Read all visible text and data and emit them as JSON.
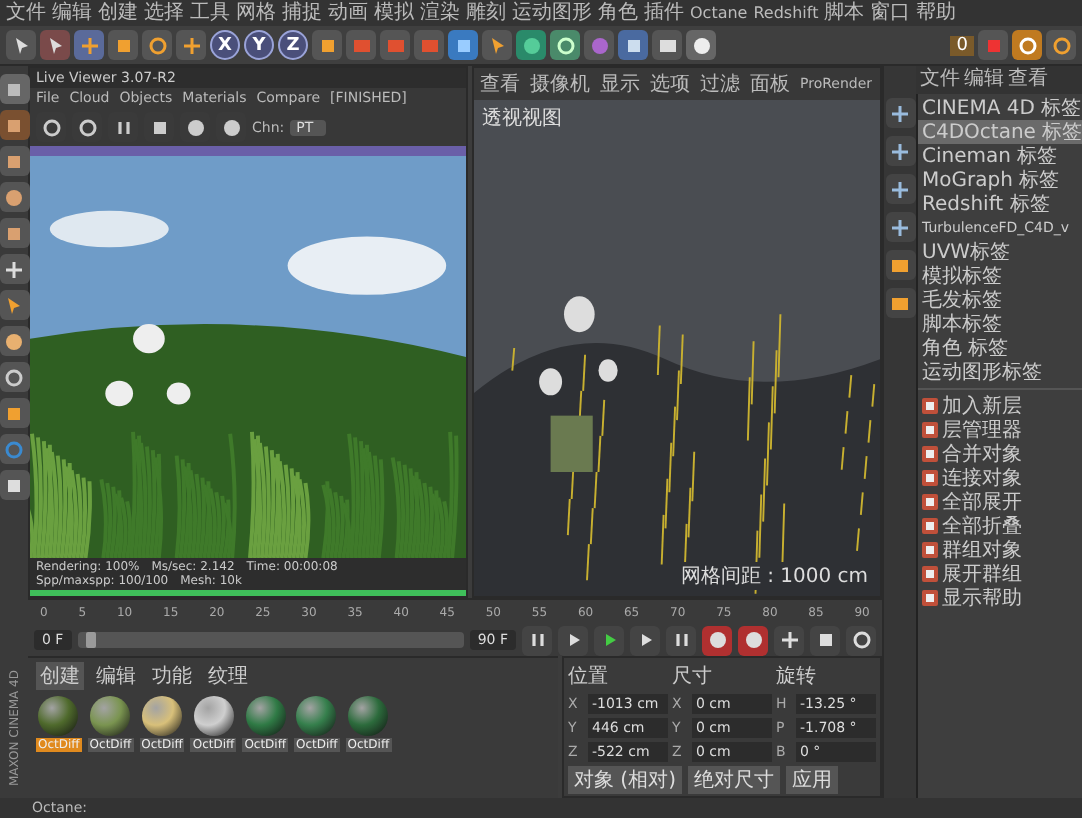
{
  "menu_bar": [
    "文件",
    "编辑",
    "创建",
    "选择",
    "工具",
    "网格",
    "捕捉",
    "动画",
    "模拟",
    "渲染",
    "雕刻",
    "运动图形",
    "角色",
    "插件",
    "Octane",
    "Redshift",
    "脚本",
    "窗口",
    "帮助"
  ],
  "toolbar": {
    "axes": [
      "X",
      "Y",
      "Z"
    ],
    "counter": "0"
  },
  "live_viewer": {
    "title": "Live Viewer 3.07-R2",
    "menu": [
      "File",
      "Cloud",
      "Objects",
      "Materials",
      "Compare"
    ],
    "state": "[FINISHED]",
    "channel_label": "Chn:",
    "channel": "PT",
    "stats": [
      "Rendering: 100%",
      "Ms/sec: 2.142",
      "Time: 00:00:08",
      "Spp/maxspp: 100/100",
      "Mesh: 10k"
    ],
    "progress": {
      "level": 1
    }
  },
  "viewport": {
    "menu": [
      "查看",
      "摄像机",
      "显示",
      "选项",
      "过滤",
      "面板",
      "ProRender"
    ],
    "label": "透视视图",
    "grid_spacing": "网格间距 : 1000 cm"
  },
  "object_manager": {
    "menu": [
      "文件",
      "编辑",
      "查看"
    ]
  },
  "tag_menu": [
    {
      "kind": "text",
      "label": "CINEMA 4D 标签",
      "selected": false
    },
    {
      "kind": "text",
      "label": "C4DOctane 标签",
      "selected": true
    },
    {
      "kind": "text",
      "label": "Cineman 标签",
      "selected": false
    },
    {
      "kind": "text",
      "label": "MoGraph 标签",
      "selected": false
    },
    {
      "kind": "text",
      "label": "Redshift 标签",
      "selected": false
    },
    {
      "kind": "text",
      "label": "TurbulenceFD_C4D_v",
      "selected": false
    },
    {
      "kind": "text",
      "label": "UVW标签",
      "selected": false
    },
    {
      "kind": "text",
      "label": "模拟标签",
      "selected": false
    },
    {
      "kind": "text",
      "label": "毛发标签",
      "selected": false
    },
    {
      "kind": "text",
      "label": "脚本标签",
      "selected": false
    },
    {
      "kind": "text",
      "label": "角色 标签",
      "selected": false
    },
    {
      "kind": "text",
      "label": "运动图形标签",
      "selected": false
    },
    {
      "kind": "separator"
    },
    {
      "kind": "icon",
      "label": "加入新层",
      "selected": false
    },
    {
      "kind": "icon",
      "label": "层管理器",
      "selected": false
    },
    {
      "kind": "icon",
      "label": "合并对象",
      "selected": false
    },
    {
      "kind": "icon",
      "label": "连接对象",
      "selected": false
    },
    {
      "kind": "icon",
      "label": "全部展开",
      "selected": false
    },
    {
      "kind": "icon",
      "label": "全部折叠",
      "selected": false
    },
    {
      "kind": "icon",
      "label": "群组对象",
      "selected": false
    },
    {
      "kind": "icon",
      "label": "展开群组",
      "selected": false
    },
    {
      "kind": "icon",
      "label": "显示帮助",
      "selected": false
    }
  ],
  "timeline": {
    "ticks": [
      "0",
      "5",
      "10",
      "15",
      "20",
      "25",
      "30",
      "35",
      "40",
      "45",
      "50",
      "55",
      "60",
      "65",
      "70",
      "75",
      "80",
      "85",
      "90"
    ],
    "start": "0 F",
    "end": "90 F",
    "slider": {
      "level": 0.03
    }
  },
  "materials": {
    "tabs": [
      {
        "label": "创建",
        "selected": true
      },
      {
        "label": "编辑",
        "selected": false
      },
      {
        "label": "功能",
        "selected": false
      },
      {
        "label": "纹理",
        "selected": false
      }
    ],
    "items": [
      {
        "name": "OctDiff",
        "color": "#4f6a2c",
        "selected": true
      },
      {
        "name": "OctDiff",
        "color": "#7a9450",
        "selected": false
      },
      {
        "name": "OctDiff",
        "color": "#d8c07a",
        "selected": false
      },
      {
        "name": "OctDiff",
        "color": "#cfcfcf",
        "selected": false
      },
      {
        "name": "OctDiff",
        "color": "#2f7a45",
        "selected": false
      },
      {
        "name": "OctDiff",
        "color": "#357f4c",
        "selected": false
      },
      {
        "name": "OctDiff",
        "color": "#2c6b3c",
        "selected": false
      }
    ]
  },
  "coordinates": {
    "headers": [
      "位置",
      "尺寸",
      "旋转"
    ],
    "rows": [
      {
        "axis": "X",
        "position": "-1013 cm",
        "size_axis": "X",
        "size": "0 cm",
        "rot_axis": "H",
        "rotation": "-13.25 °"
      },
      {
        "axis": "Y",
        "position": "446 cm",
        "size_axis": "Y",
        "size": "0 cm",
        "rot_axis": "P",
        "rotation": "-1.708 °"
      },
      {
        "axis": "Z",
        "position": "-522 cm",
        "size_axis": "Z",
        "size": "0 cm",
        "rot_axis": "B",
        "rotation": "0 °"
      }
    ],
    "buttons": [
      "对象 (相对)",
      "绝对尺寸",
      "应用"
    ]
  },
  "side_label": "MAXON CINEMA 4D",
  "status_bar": {
    "text": "Octane:"
  }
}
